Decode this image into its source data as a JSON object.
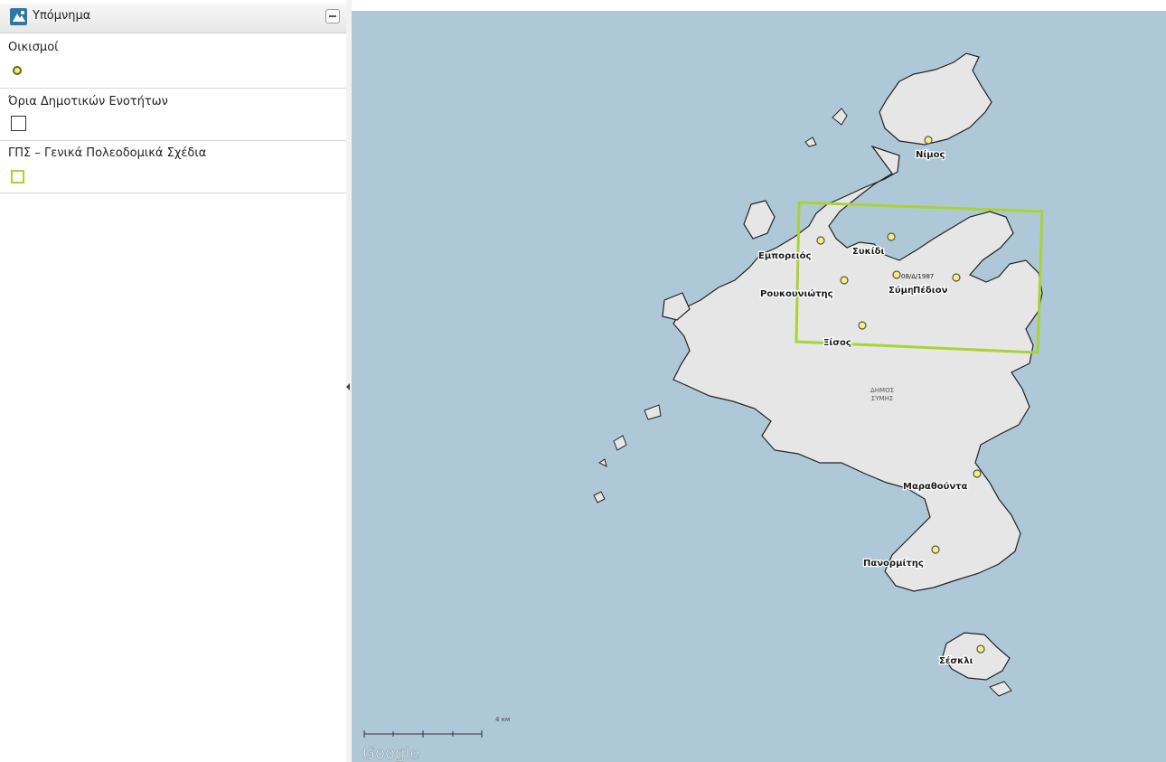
{
  "legend": {
    "title": "Υπόμνημα",
    "items": [
      {
        "label": "Οικισμοί"
      },
      {
        "label": "Όρια Δημοτικών Ενοτήτων"
      },
      {
        "label": "ΓΠΣ – Γενικά Πολεοδομικά Σχέδια"
      }
    ]
  },
  "map": {
    "places": {
      "nimos": "Νίμος",
      "emporeios": "Εμπορειός",
      "sykidi": "Συκίδι",
      "symi": "Σύμη",
      "pedion": "Πέδιον",
      "date": "08/Δ/1987",
      "roukouniotis": "Ρουκουνιώτης",
      "xisos": "Ξίσος",
      "marathounta": "Μαραθούντα",
      "panormitis": "Πανορμίτης",
      "seskli": "Σέσκλι"
    },
    "municipality_line1": "ΔΗΜΟΣ",
    "municipality_line2": "ΣΥΜΗΣ",
    "scale_label": "4 км",
    "attribution": "Google",
    "colors": {
      "sea": "#aec8d8",
      "land": "#e6e6e6",
      "settlement": "#f4f07a",
      "plan_boundary": "#a9d332"
    }
  }
}
